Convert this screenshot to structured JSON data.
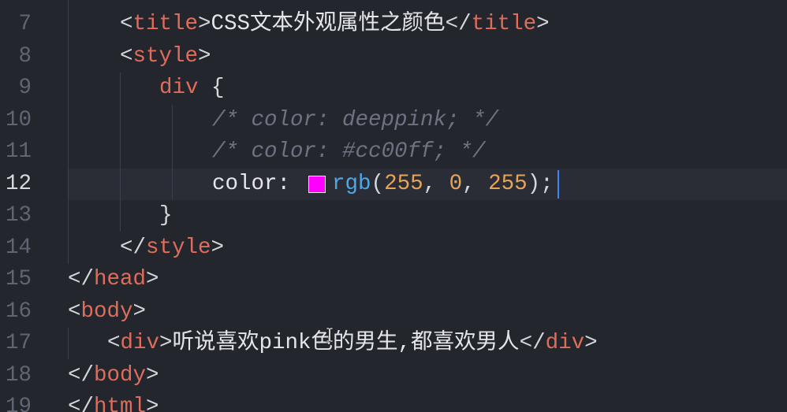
{
  "editor": {
    "color_swatch": "#ff00ff",
    "lines": [
      {
        "number": "7",
        "code": [
          "<",
          "title",
          ">",
          "CSS文本外观属性之颜色",
          "</",
          "title",
          ">"
        ]
      },
      {
        "number": "8",
        "code": [
          "<",
          "style",
          ">"
        ]
      },
      {
        "number": "9",
        "code": [
          "div",
          " {"
        ]
      },
      {
        "number": "10",
        "code": [
          "/* color: deeppink; */"
        ]
      },
      {
        "number": "11",
        "code": [
          "/* color: #cc00ff; */"
        ]
      },
      {
        "number": "12",
        "current": true,
        "code": [
          "color:",
          "rgb",
          "(",
          "255",
          ", ",
          "0",
          ", ",
          "255",
          ");"
        ]
      },
      {
        "number": "13",
        "code": [
          "}"
        ]
      },
      {
        "number": "14",
        "code": [
          "</",
          "style",
          ">"
        ]
      },
      {
        "number": "15",
        "code": [
          "</",
          "head",
          ">"
        ]
      },
      {
        "number": "16",
        "code": [
          "<",
          "body",
          ">"
        ]
      },
      {
        "number": "17",
        "code": [
          "<",
          "div",
          ">",
          "听说喜欢pink色的男生,都喜欢男人",
          "</",
          "div",
          ">"
        ]
      },
      {
        "number": "18",
        "code": [
          "</",
          "body",
          ">"
        ]
      },
      {
        "number": "19",
        "code": [
          "</",
          "html",
          ">"
        ]
      }
    ]
  },
  "theme": {
    "background": "#23262d",
    "current_line": "#2a2d35",
    "indent_guide": "#3b3f49",
    "line_number": "#5f6671",
    "line_number_current": "#d5d8dd",
    "punctuation": "#d4d7dc",
    "tag": "#e06c5a",
    "text": "#e4e6ea",
    "comment": "#6d7380",
    "function": "#4fa6e8",
    "number": "#e5a45a",
    "caret": "#3f86f5"
  }
}
